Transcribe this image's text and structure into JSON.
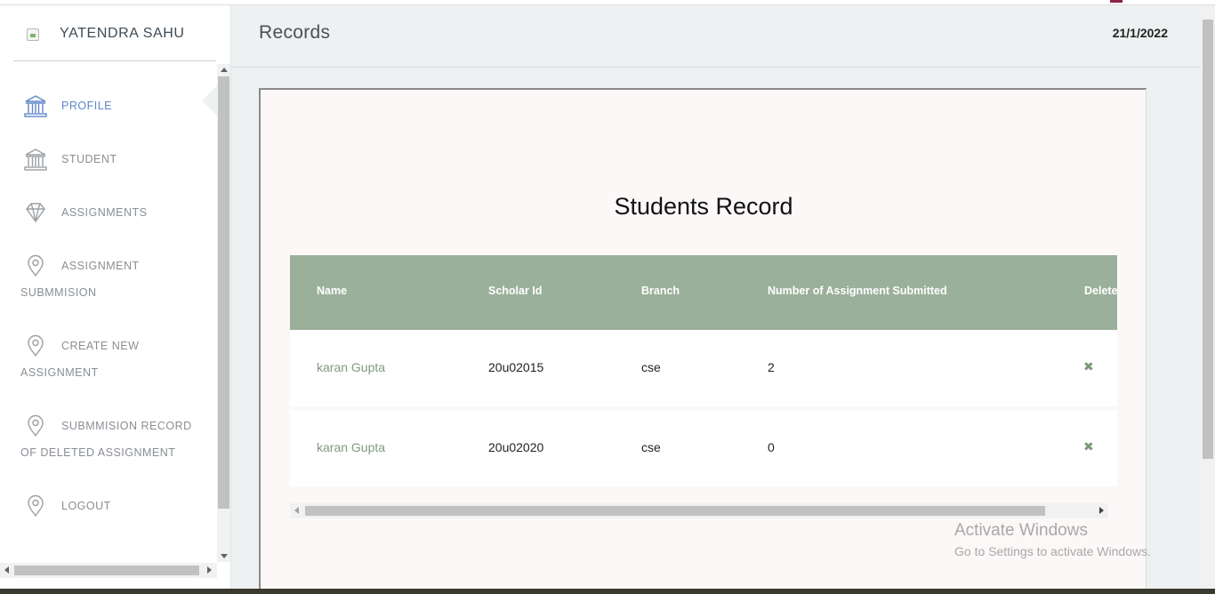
{
  "sidebar": {
    "user_name": "YATENDRA SAHU",
    "items": [
      {
        "line1": "PROFILE",
        "line2": "",
        "icon": "bank-icon",
        "active": true
      },
      {
        "line1": "STUDENT",
        "line2": "",
        "icon": "bank-icon",
        "active": false
      },
      {
        "line1": "ASSIGNMENTS",
        "line2": "",
        "icon": "diamond-icon",
        "active": false
      },
      {
        "line1": "ASSIGNMENT",
        "line2": "SUBMMISION",
        "icon": "location-pin-icon",
        "active": false
      },
      {
        "line1": "CREATE NEW",
        "line2": "ASSIGNMENT",
        "icon": "location-pin-icon",
        "active": false
      },
      {
        "line1": "SUBMMISION RECORD",
        "line2": "OF DELETED ASSIGNMENT",
        "icon": "location-pin-icon",
        "active": false
      },
      {
        "line1": "LOGOUT",
        "line2": "",
        "icon": "location-pin-icon",
        "active": false
      }
    ]
  },
  "header": {
    "title": "Records",
    "date": "21/1/2022"
  },
  "card": {
    "title": "Students Record",
    "columns": [
      "Name",
      "Scholar Id",
      "Branch",
      "Number of Assignment Submitted",
      "Delete"
    ],
    "rows": [
      {
        "name": "karan Gupta",
        "scholar_id": "20u02015",
        "branch": "cse",
        "submitted": "2",
        "delete_icon": "✖"
      },
      {
        "name": "karan Gupta",
        "scholar_id": "20u02020",
        "branch": "cse",
        "submitted": "0",
        "delete_icon": "✖"
      }
    ]
  },
  "watermark": {
    "line1": "Activate Windows",
    "line2": "Go to Settings to activate Windows."
  },
  "colors": {
    "accent_active": "#5f86c9",
    "table_header": "#9bb09a",
    "name_link": "#7f9c7d"
  }
}
